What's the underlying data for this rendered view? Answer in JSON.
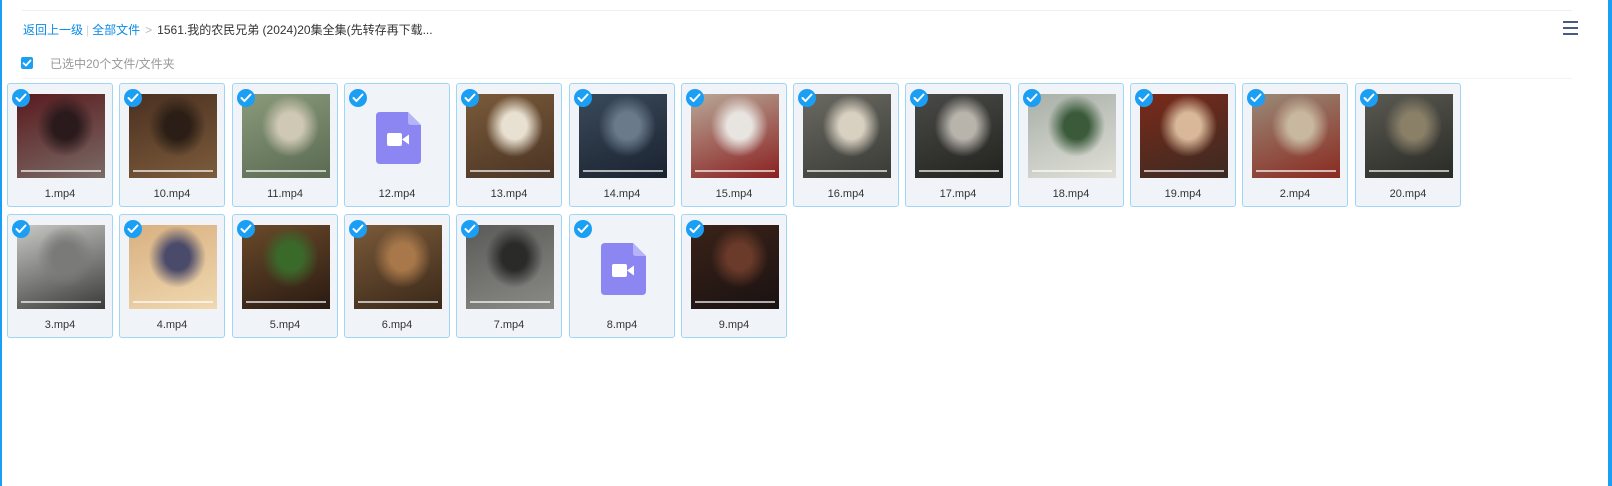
{
  "breadcrumb": {
    "back": "返回上一级",
    "all_files": "全部文件",
    "separator": ">",
    "current": "1561.我的农民兄弟 (2024)20集全集(先转存再下载..."
  },
  "selection": {
    "label": "已选中20个文件/文件夹"
  },
  "icons": {
    "menu": "hamburger-menu-icon",
    "check": "check-circle-icon",
    "video": "video-file-icon"
  },
  "colors": {
    "accent": "#1a9ff5",
    "card_border": "#9fd5f5",
    "card_bg": "#f0f4f9",
    "video_icon": "#8b86f2"
  },
  "files": [
    {
      "name": "1.mp4",
      "thumb": "video-still-1",
      "colors": [
        "#5a1a1e",
        "#2a1a1c",
        "#7a6b66"
      ]
    },
    {
      "name": "10.mp4",
      "thumb": "video-still-10",
      "colors": [
        "#4a3020",
        "#2a1e16",
        "#7d5c3c"
      ]
    },
    {
      "name": "11.mp4",
      "thumb": "video-still-11",
      "colors": [
        "#8a9a7a",
        "#cfc8b4",
        "#5a6a52"
      ]
    },
    {
      "name": "12.mp4",
      "thumb": "video-file-icon",
      "colors": []
    },
    {
      "name": "13.mp4",
      "thumb": "video-still-13",
      "colors": [
        "#7a5a3a",
        "#e8e0d0",
        "#4a3424"
      ]
    },
    {
      "name": "14.mp4",
      "thumb": "video-still-14",
      "colors": [
        "#3a4a5a",
        "#6a7a8a",
        "#1a2230"
      ]
    },
    {
      "name": "15.mp4",
      "thumb": "video-still-15",
      "colors": [
        "#b8a898",
        "#e8e4e0",
        "#8a2020"
      ]
    },
    {
      "name": "16.mp4",
      "thumb": "video-still-16",
      "colors": [
        "#6a6a62",
        "#d8d0c0",
        "#3a3a36"
      ]
    },
    {
      "name": "17.mp4",
      "thumb": "video-still-17",
      "colors": [
        "#4a4a48",
        "#b8b4ac",
        "#22221e"
      ]
    },
    {
      "name": "18.mp4",
      "thumb": "video-still-18",
      "colors": [
        "#a8b0a8",
        "#3a5a3a",
        "#e0e0d8"
      ]
    },
    {
      "name": "19.mp4",
      "thumb": "video-still-19",
      "colors": [
        "#7a2a1a",
        "#d8b898",
        "#3a2a22"
      ]
    },
    {
      "name": "2.mp4",
      "thumb": "video-still-2",
      "colors": [
        "#9a8a78",
        "#c8b8a0",
        "#8a2a20"
      ]
    },
    {
      "name": "20.mp4",
      "thumb": "video-still-20",
      "colors": [
        "#5a5a52",
        "#8a8068",
        "#2a2a26"
      ]
    },
    {
      "name": "3.mp4",
      "thumb": "video-still-3",
      "colors": [
        "#c8c8c4",
        "#7a7a78",
        "#3a3a3a"
      ]
    },
    {
      "name": "4.mp4",
      "thumb": "video-still-4",
      "colors": [
        "#d8b080",
        "#4a4a6a",
        "#f0d8b0"
      ]
    },
    {
      "name": "5.mp4",
      "thumb": "video-still-5",
      "colors": [
        "#6a4a2a",
        "#3a6a2a",
        "#2a1a12"
      ]
    },
    {
      "name": "6.mp4",
      "thumb": "video-still-6",
      "colors": [
        "#7a5a3a",
        "#a8784a",
        "#3a2818"
      ]
    },
    {
      "name": "7.mp4",
      "thumb": "video-still-7",
      "colors": [
        "#5a5a58",
        "#2a2a28",
        "#8a8a86"
      ]
    },
    {
      "name": "8.mp4",
      "thumb": "video-file-icon",
      "colors": []
    },
    {
      "name": "9.mp4",
      "thumb": "video-still-9",
      "colors": [
        "#3a2218",
        "#6a3a2a",
        "#1a1212"
      ]
    }
  ]
}
